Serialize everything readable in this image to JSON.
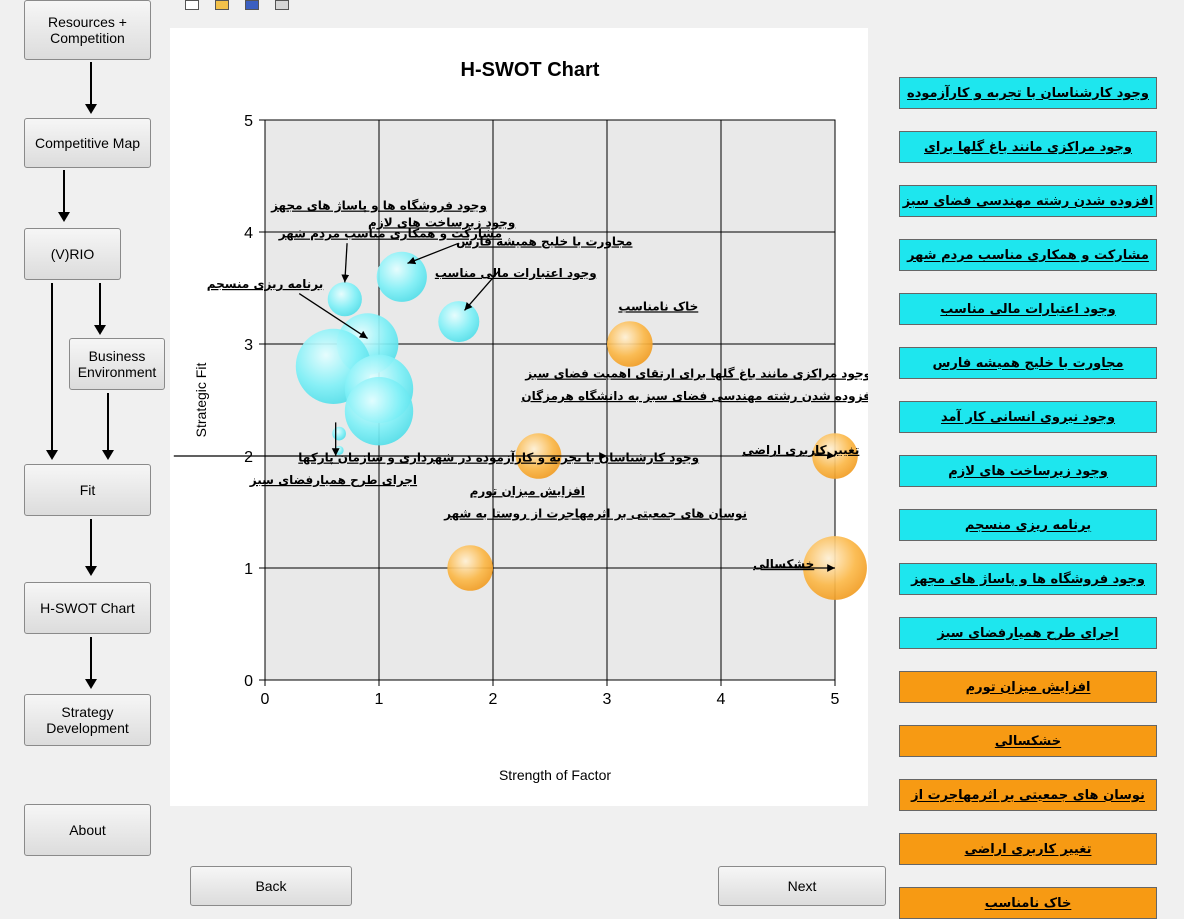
{
  "nav": {
    "resources": "Resources +\nCompetition",
    "competitive_map": "Competitive Map",
    "vrio": "(V)RIO",
    "business_env": "Business\nEnvironment",
    "fit": "Fit",
    "hswot": "H-SWOT Chart",
    "strategy": "Strategy\nDevelopment",
    "about": "About"
  },
  "toolbar": {
    "icons": [
      "new-file-icon",
      "open-folder-icon",
      "save-icon",
      "print-icon"
    ]
  },
  "bottom": {
    "back": "Back",
    "next": "Next"
  },
  "colors": {
    "strength": "#1ee6ee",
    "weakness": "#f79a13",
    "bubble_s": "#7ff0f7",
    "bubble_w": "#fbb848"
  },
  "chart_data": {
    "type": "scatter",
    "title": "H-SWOT Chart",
    "xlabel": "Strength of Factor",
    "ylabel": "Strategic Fit",
    "xlim": [
      0,
      5
    ],
    "ylim": [
      0,
      5
    ],
    "xticks": [
      "0",
      "1",
      "2",
      "3",
      "4",
      "5"
    ],
    "yticks": [
      "0",
      "1",
      "2",
      "3",
      "4",
      "5"
    ],
    "grid": true,
    "series": [
      {
        "category": "strength",
        "points": [
          {
            "x": 0.7,
            "y": 3.4,
            "size": 0.15,
            "label": "وجود فروشگاه ها و پاساژ های مجهز"
          },
          {
            "x": 1.2,
            "y": 3.6,
            "size": 0.22,
            "label": "وجود زیرساخت های لازم"
          },
          {
            "x": 1.7,
            "y": 3.2,
            "size": 0.18,
            "label": "وجود اعتبارات مالی مناسب"
          },
          {
            "x": 0.9,
            "y": 3.0,
            "size": 0.27,
            "label": "برنامه ریزی منسجم"
          },
          {
            "x": 0.6,
            "y": 2.8,
            "size": 0.33,
            "label": "مشارکت و همکاری مناسب مردم شهر"
          },
          {
            "x": 1.0,
            "y": 2.6,
            "size": 0.3,
            "label": "وجود مراکزی مانند باغ گلها برای ارتقای اهمیت فضای سبز"
          },
          {
            "x": 1.0,
            "y": 2.4,
            "size": 0.3,
            "label": "افزوده شدن رشته مهندسی فضای سبز به دانشگاه هرمزگان"
          },
          {
            "x": 0.65,
            "y": 2.2,
            "size": 0.06,
            "label": "وجود کارشناسان با تجربه و کارآزموده در شهرداری و سازمان پارکها"
          },
          {
            "x": 0.65,
            "y": 2.05,
            "size": 0.04,
            "label": "اجرای طرح همیارفضای سبز"
          }
        ]
      },
      {
        "category": "weakness",
        "points": [
          {
            "x": 3.2,
            "y": 3.0,
            "size": 0.2,
            "label": "خاک نامناسب"
          },
          {
            "x": 2.4,
            "y": 2.0,
            "size": 0.2,
            "label": "افزایش میزان تورم"
          },
          {
            "x": 5.0,
            "y": 2.0,
            "size": 0.2,
            "label": "تغییر کاربری اراضی"
          },
          {
            "x": 1.8,
            "y": 1.0,
            "size": 0.2,
            "label": "نوسان های جمعیتی بر اثرمهاجرت از روستا به شهر"
          },
          {
            "x": 5.0,
            "y": 1.0,
            "size": 0.28,
            "label": "خشکسالی"
          }
        ]
      }
    ],
    "annotations": [
      {
        "text": "وجود فروشگاه ها و پاساژ های مجهز",
        "x": 1.0,
        "y": 4.2
      },
      {
        "text": "وجود زیرساخت های لازم",
        "x": 1.55,
        "y": 4.05
      },
      {
        "text": "مشارکت و همکاری مناسب مردم شهر",
        "x": 1.1,
        "y": 3.95
      },
      {
        "text": "مجاورت با خلیج همیشه فارس",
        "x": 2.45,
        "y": 3.88
      },
      {
        "text": "وجود اعتبارات مالی مناسب",
        "x": 2.2,
        "y": 3.6
      },
      {
        "text": "برنامه ریزی منسجم",
        "x": 0.0,
        "y": 3.5
      },
      {
        "text": "خاک نامناسب",
        "x": 3.45,
        "y": 3.3
      },
      {
        "text": "وجود مراکزی مانند باغ گلها برای ارتقای اهمیت فضای سبز",
        "x": 3.8,
        "y": 2.7
      },
      {
        "text": "افزوده شدن رشته مهندسی فضای سبز به دانشگاه هرمزگان",
        "x": 3.8,
        "y": 2.5
      },
      {
        "text": "وجود کارشناسان با تجربه و کارآزموده در شهرداری و سازمان پارکها",
        "x": 2.05,
        "y": 1.95
      },
      {
        "text": "اجرای طرح همیارفضای سبز",
        "x": 0.6,
        "y": 1.75
      },
      {
        "text": "تغییر کاربری اراضی",
        "x": 4.7,
        "y": 2.02
      },
      {
        "text": "افزایش میزان تورم",
        "x": 2.3,
        "y": 1.65
      },
      {
        "text": "نوسان های جمعیتی بر اثرمهاجرت از روستا به شهر",
        "x": 2.9,
        "y": 1.45
      },
      {
        "text": "خشکسالی",
        "x": 4.55,
        "y": 1.0
      }
    ]
  },
  "side": {
    "strengths": [
      "وجود کارشناسان با تجربه و کارآزموده",
      "وجود مراکزی مانند باغ گلها برای",
      "افزوده شدن رشته مهندسی فضای سبز",
      "مشارکت و همکاری مناسب مردم شهر",
      "وجود اعتبارات مالی مناسب",
      "مجاورت با خلیج همیشه فارس",
      "وجود نیروی انسانی کار آمد",
      "وجود زیرساخت های لازم",
      "برنامه ریزی منسجم",
      "وجود فروشگاه ها و پاساژ های مجهز",
      "اجرای طرح همیارفضای سبز"
    ],
    "weaknesses": [
      "افزایش میزان تورم",
      "خشکسالی",
      "نوسان های جمعیتی بر اثرمهاجرت از",
      "تغییر کاربری اراضی",
      "خاک نامناسب"
    ]
  }
}
